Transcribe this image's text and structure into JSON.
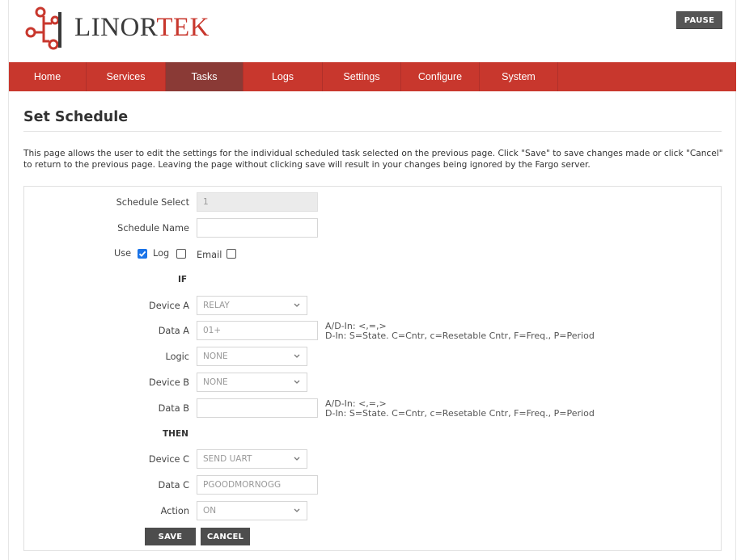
{
  "brand": {
    "name_part1": "LINOR",
    "name_part2": "TEK"
  },
  "header": {
    "pause_label": "PAUSE"
  },
  "nav": {
    "items": [
      {
        "label": "Home"
      },
      {
        "label": "Services"
      },
      {
        "label": "Tasks"
      },
      {
        "label": "Logs"
      },
      {
        "label": "Settings"
      },
      {
        "label": "Configure"
      },
      {
        "label": "System"
      }
    ],
    "active": "Tasks"
  },
  "page": {
    "title": "Set Schedule",
    "description": "This page allows the user to edit the settings for the individual scheduled task selected on the previous page. Click \"Save\" to save changes made or click \"Cancel\" to return to the previous page. Leaving the page without clicking save will result in your changes being ignored by the Fargo server."
  },
  "form": {
    "schedule_select": {
      "label": "Schedule Select",
      "value": "1"
    },
    "schedule_name": {
      "label": "Schedule Name",
      "value": ""
    },
    "use": {
      "label": "Use",
      "checked": true
    },
    "log": {
      "label": "Log",
      "checked": false
    },
    "email": {
      "label": "Email",
      "checked": false
    },
    "if_label": "IF",
    "device_a": {
      "label": "Device A",
      "value": "RELAY"
    },
    "data_a": {
      "label": "Data A",
      "value": "01+"
    },
    "hint_ad": "A/D-In: <,=,>",
    "hint_d": "D-In: S=State. C=Cntr, c=Resetable Cntr, F=Freq., P=Period",
    "logic": {
      "label": "Logic",
      "value": "NONE"
    },
    "device_b": {
      "label": "Device B",
      "value": "NONE"
    },
    "data_b": {
      "label": "Data B",
      "value": ""
    },
    "then_label": "THEN",
    "device_c": {
      "label": "Device C",
      "value": "SEND UART"
    },
    "data_c": {
      "label": "Data C",
      "value": "PGOODMORNOGG"
    },
    "action": {
      "label": "Action",
      "value": "ON"
    },
    "save_label": "SAVE",
    "cancel_label": "CANCEL"
  },
  "colors": {
    "brand_red": "#c8372d",
    "nav_active": "#8a3a36",
    "button_dark": "#4d4d4d",
    "checkbox_blue": "#1a73e8"
  },
  "icons": [
    "linortek-logo-icon",
    "chevron-down-icon",
    "check-icon"
  ]
}
